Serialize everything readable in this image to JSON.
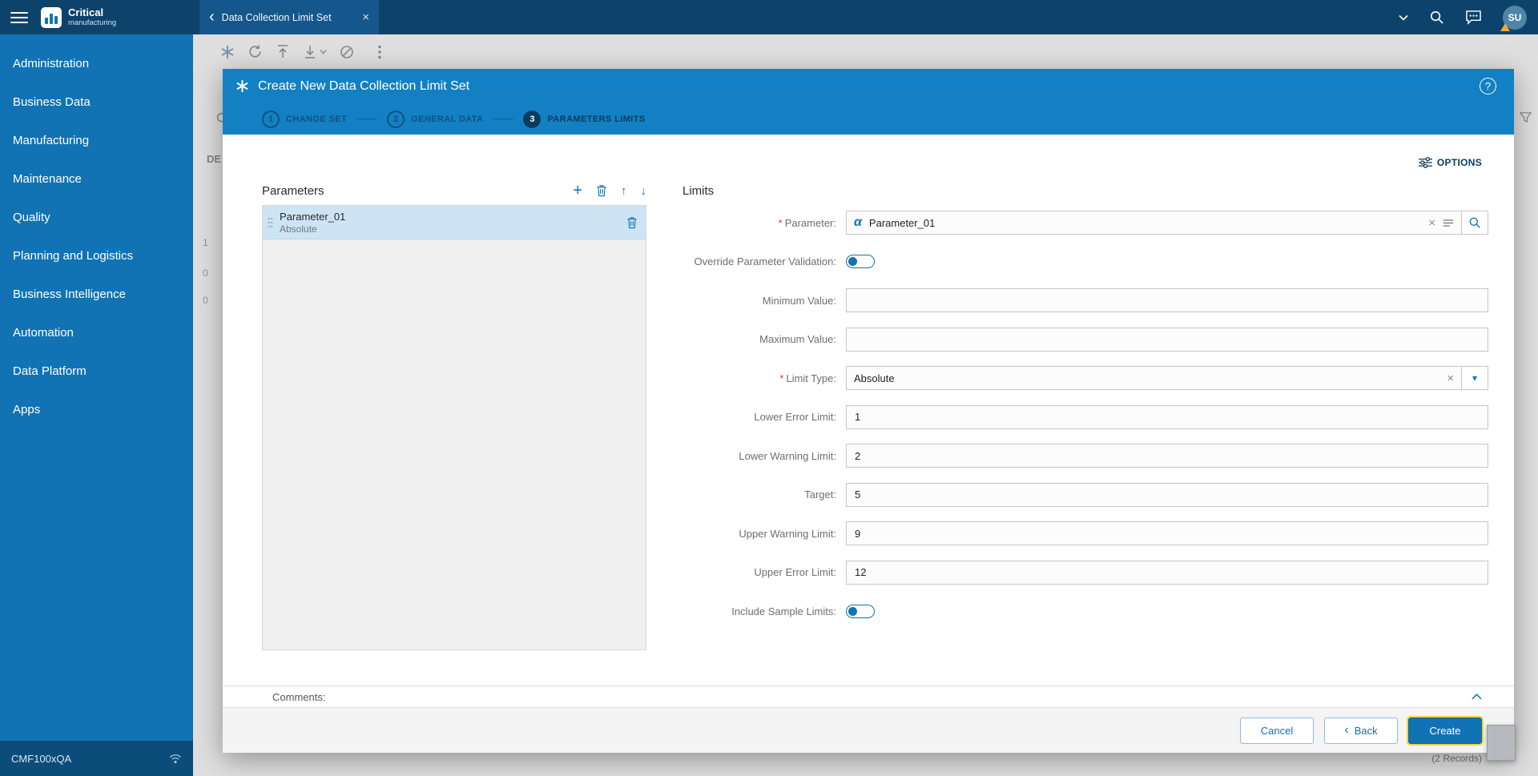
{
  "topbar": {
    "logo_title": "Critical",
    "logo_subtitle": "manufacturing",
    "tab_label": "Data Collection Limit Set",
    "user_initials": "SU"
  },
  "sidebar": {
    "items": [
      {
        "label": "Administration"
      },
      {
        "label": "Business Data"
      },
      {
        "label": "Manufacturing"
      },
      {
        "label": "Maintenance"
      },
      {
        "label": "Quality"
      },
      {
        "label": "Planning and Logistics"
      },
      {
        "label": "Business Intelligence"
      },
      {
        "label": "Automation"
      },
      {
        "label": "Data Platform"
      },
      {
        "label": "Apps"
      }
    ],
    "footer_label": "CMF100xQA"
  },
  "background": {
    "partial_label": "DE",
    "row_numbers": [
      "1",
      "0",
      "0"
    ],
    "records_label": "(2 Records)"
  },
  "icons": {
    "back_chevron": "‹",
    "close": "×",
    "plus": "+",
    "arrow_up": "↑",
    "arrow_down": "↓",
    "alpha": "α",
    "dropdown_caret": "▾",
    "question_mark": "?"
  },
  "modal": {
    "title": "Create New Data Collection Limit Set",
    "steps": [
      {
        "number": "1",
        "label": "CHANGE SET"
      },
      {
        "number": "2",
        "label": "GENERAL DATA"
      },
      {
        "number": "3",
        "label": "PARAMETERS LIMITS"
      }
    ],
    "options_label": "OPTIONS",
    "parameters_panel": {
      "title": "Parameters",
      "items": [
        {
          "name": "Parameter_01",
          "subtitle": "Absolute"
        }
      ]
    },
    "limits_panel": {
      "title": "Limits",
      "required_marker": "*",
      "fields": {
        "parameter": {
          "label": "Parameter:",
          "value": "Parameter_01"
        },
        "override_validation": {
          "label": "Override Parameter Validation:"
        },
        "minimum_value": {
          "label": "Minimum Value:",
          "value": ""
        },
        "maximum_value": {
          "label": "Maximum Value:",
          "value": ""
        },
        "limit_type": {
          "label": "Limit Type:",
          "value": "Absolute"
        },
        "lower_error": {
          "label": "Lower Error Limit:",
          "value": "1"
        },
        "lower_warning": {
          "label": "Lower Warning Limit:",
          "value": "2"
        },
        "target": {
          "label": "Target:",
          "value": "5"
        },
        "upper_warning": {
          "label": "Upper Warning Limit:",
          "value": "9"
        },
        "upper_error": {
          "label": "Upper Error Limit:",
          "value": "12"
        },
        "include_sample": {
          "label": "Include Sample Limits:"
        }
      }
    },
    "comments_label": "Comments:",
    "footer": {
      "cancel": "Cancel",
      "back": "Back",
      "create": "Create"
    }
  },
  "colors": {
    "topbar": "#0d436b",
    "sidebar": "#1173b4",
    "accent": "#1173b4",
    "modal_header": "#1380c4",
    "step_active": "#0a3c61",
    "focus_ring": "#f2d43d",
    "selected_item": "#cde4f5"
  }
}
